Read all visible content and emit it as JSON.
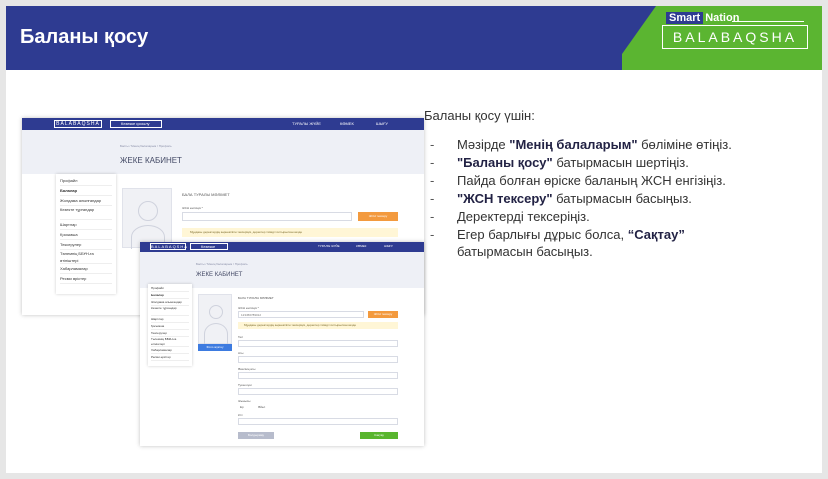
{
  "slide": {
    "title": "Баланы қосу"
  },
  "brand": {
    "tag_chip": "Smart",
    "tag_rest": "Nation",
    "name": "BALABAQSHA"
  },
  "screenshot": {
    "logo": "BALABAQSHA",
    "nav_button": "Кезекке қосылу",
    "nav_items": [
      "ТУРАЛЫ ЖҮЙЕ",
      "КӨМЕК",
      "ШЫҒУ"
    ],
    "breadcrumb": "Басты / Менің балаларым / Профиль",
    "page_title": "ЖЕКЕ КАБИНЕТ",
    "sidebar": [
      "Профайл",
      "Балалар",
      "Жолдама алынғандар",
      "Кезекте тұрғандар",
      "Шартлар",
      "Қосымша",
      "Тексерулер",
      "Төлемнің ББҰН-ға өтініштері",
      "Хабарламалар",
      "Ресми өрістер"
    ],
    "section_title": "БАЛА ТУРАЛЫ МӘЛІМЕТ",
    "iin_label": "ЖСН енгізіңіз *",
    "iin_value": "123456789012",
    "check_button": "ЖСН тексеру",
    "warning": "Мұндағы деректердің көрнекілігін тексеріңіз, деректер тиімді толтырылған кезде",
    "upload_button": "Фото жүктеу",
    "fields": [
      "Тегі",
      "Аты",
      "Әкесінің аты",
      "Туған күні",
      "Жынысы",
      "Ұлт"
    ],
    "gender": [
      "Ер",
      "Әйел"
    ],
    "cancel_button": "Болдырмау",
    "save_button": "Сақтау"
  },
  "instructions": {
    "title": "Баланы қосу үшін:",
    "steps": [
      {
        "pre": "Мәзірде ",
        "bold": "\"Менің балаларым\"",
        "post": " бөліміне өтіңіз."
      },
      {
        "pre": "",
        "bold": "\"Баланы қосу\"",
        "post": " батырмасын шертіңіз."
      },
      {
        "pre": "Пайда болған өріске баланың ЖСН енгізіңіз.",
        "bold": "",
        "post": ""
      },
      {
        "pre": "",
        "bold": "\"ЖСН тексеру\"",
        "post": " батырмасын басыңыз."
      },
      {
        "pre": "Деректерді тексеріңіз.",
        "bold": "",
        "post": ""
      },
      {
        "pre": "Егер барлығы дұрыс болса, ",
        "bold": "“Сақтау”",
        "post": " батырмасын басыңыз."
      }
    ]
  }
}
